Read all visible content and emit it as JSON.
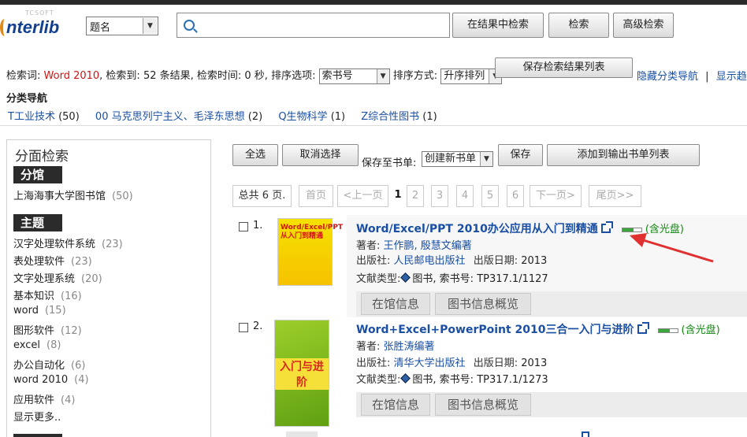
{
  "logo": {
    "small": "TCSOFT",
    "big": "nterlib"
  },
  "search": {
    "field": "题名",
    "placeholder": ""
  },
  "buttons": {
    "search_in_results": "在结果中检索",
    "search": "检索",
    "advanced": "高级检索"
  },
  "summary": {
    "label_word": "检索词:",
    "word": "Word 2010",
    "rest": ", 检索到: 52 条结果, 检索时间: 0 秒, 排序选项:",
    "sort_field": "索书号",
    "sort_order_label": "排序方式:",
    "sort_order": "升序排列",
    "save_list": "保存检索结果列表",
    "hide_nav": "隐藏分类导航",
    "separator": "|",
    "show_more": "显示趋势"
  },
  "catnav": {
    "title": "分类导航",
    "items": [
      {
        "label": "T工业技术",
        "count": "(50)"
      },
      {
        "label": "00 马克思列宁主义、毛泽东思想",
        "count": "(2)"
      },
      {
        "label": "Q生物科学",
        "count": "(1)"
      },
      {
        "label": "Z综合性图书",
        "count": "(1)"
      }
    ]
  },
  "facet": {
    "title": "分面检索",
    "branch_head": "分馆",
    "branch": {
      "label": "上海海事大学图书馆",
      "count": "(50)"
    },
    "topic_head": "主题",
    "topics": [
      {
        "label": "汉字处理软件系统",
        "count": "(23)"
      },
      {
        "label": "表处理软件",
        "count": "(23)"
      },
      {
        "label": "文字处理系统",
        "count": "(20)"
      },
      {
        "label": "基本知识",
        "count": "(16)"
      },
      {
        "label": "word",
        "count": "(15)"
      },
      {
        "label": "图形软件",
        "count": "(12)"
      },
      {
        "label": "excel",
        "count": "(8)"
      },
      {
        "label": "办公自动化",
        "count": "(6)"
      },
      {
        "label": "word 2010",
        "count": "(4)"
      },
      {
        "label": "应用软件",
        "count": "(4)"
      }
    ],
    "more": "显示更多.."
  },
  "toolbar": {
    "select_all": "全选",
    "deselect": "取消选择",
    "save_to": "保存至书单:",
    "new_list": "创建新书单",
    "save": "保存",
    "add_output": "添加到输出书单列表"
  },
  "pager": {
    "total": "总共 6 页.",
    "first": "首页",
    "prev": "<上一页",
    "pages": [
      "1",
      "2",
      "3",
      "4",
      "5",
      "6"
    ],
    "next": "下一页>",
    "last": "尾页>>"
  },
  "results": [
    {
      "num": "1.",
      "title": "Word/Excel/PPT 2010办公应用从入门到精通",
      "disc": "(含光盘)",
      "author_label": "著者:",
      "author": "王作鹏, 殷慧文编著",
      "publisher_label": "出版社:",
      "publisher": "人民邮电出版社",
      "date_label": "出版日期:",
      "date": "2013",
      "type_label": "文献类型:",
      "type": "图书",
      "callno_label": "索书号:",
      "callno": "TP317.1/1127",
      "tab1": "在馆信息",
      "tab2": "图书信息概览",
      "cover_text": "Word/Excel/PPT 从入门到精通"
    },
    {
      "num": "2.",
      "title": "Word+Excel+PowerPoint 2010三合一入门与进阶",
      "disc": "(含光盘)",
      "author_label": "著者:",
      "author": "张胜涛编著",
      "publisher_label": "出版社:",
      "publisher": "清华大学出版社",
      "date_label": "出版日期:",
      "date": "2013",
      "type_label": "文献类型:",
      "type": "图书",
      "callno_label": "索书号:",
      "callno": "TP317.1/1273",
      "tab1": "在馆信息",
      "tab2": "图书信息概览",
      "cover_text": "入门与进阶"
    }
  ],
  "colors": {
    "accent": "#1a4fa3",
    "red": "#d21515",
    "green": "#118811",
    "arrow": "#e03030"
  }
}
